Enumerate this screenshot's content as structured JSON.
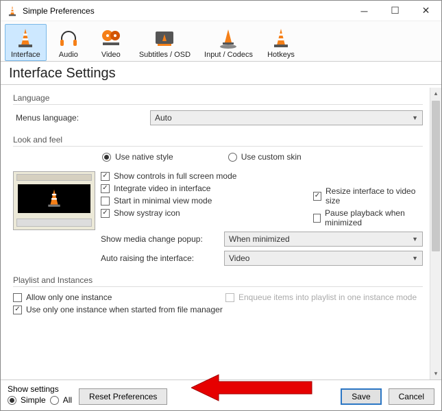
{
  "window": {
    "title": "Simple Preferences"
  },
  "categories": [
    {
      "id": "interface",
      "label": "Interface",
      "selected": true
    },
    {
      "id": "audio",
      "label": "Audio",
      "selected": false
    },
    {
      "id": "video",
      "label": "Video",
      "selected": false
    },
    {
      "id": "subtitles",
      "label": "Subtitles / OSD",
      "selected": false
    },
    {
      "id": "codecs",
      "label": "Input / Codecs",
      "selected": false
    },
    {
      "id": "hotkeys",
      "label": "Hotkeys",
      "selected": false
    }
  ],
  "heading": "Interface Settings",
  "language": {
    "group": "Language",
    "menus_label": "Menus language:",
    "menus_value": "Auto"
  },
  "lookfeel": {
    "group": "Look and feel",
    "style_native": "Use native style",
    "style_custom": "Use custom skin",
    "style_selected": "native",
    "show_controls": {
      "label": "Show controls in full screen mode",
      "checked": true
    },
    "integrate_video": {
      "label": "Integrate video in interface",
      "checked": true
    },
    "resize_interface": {
      "label": "Resize interface to video size",
      "checked": true
    },
    "start_minimal": {
      "label": "Start in minimal view mode",
      "checked": false
    },
    "pause_minimized": {
      "label": "Pause playback when minimized",
      "checked": false
    },
    "show_systray": {
      "label": "Show systray icon",
      "checked": true
    },
    "media_popup_label": "Show media change popup:",
    "media_popup_value": "When minimized",
    "auto_raise_label": "Auto raising the interface:",
    "auto_raise_value": "Video"
  },
  "playlist": {
    "group": "Playlist and Instances",
    "one_instance": {
      "label": "Allow only one instance",
      "checked": false
    },
    "enqueue": {
      "label": "Enqueue items into playlist in one instance mode",
      "checked": false,
      "disabled": true
    },
    "one_instance_filemgr": {
      "label": "Use only one instance when started from file manager",
      "checked": true
    }
  },
  "footer": {
    "show_settings_label": "Show settings",
    "simple": "Simple",
    "all": "All",
    "selected": "simple",
    "reset": "Reset Preferences",
    "save": "Save",
    "cancel": "Cancel"
  }
}
